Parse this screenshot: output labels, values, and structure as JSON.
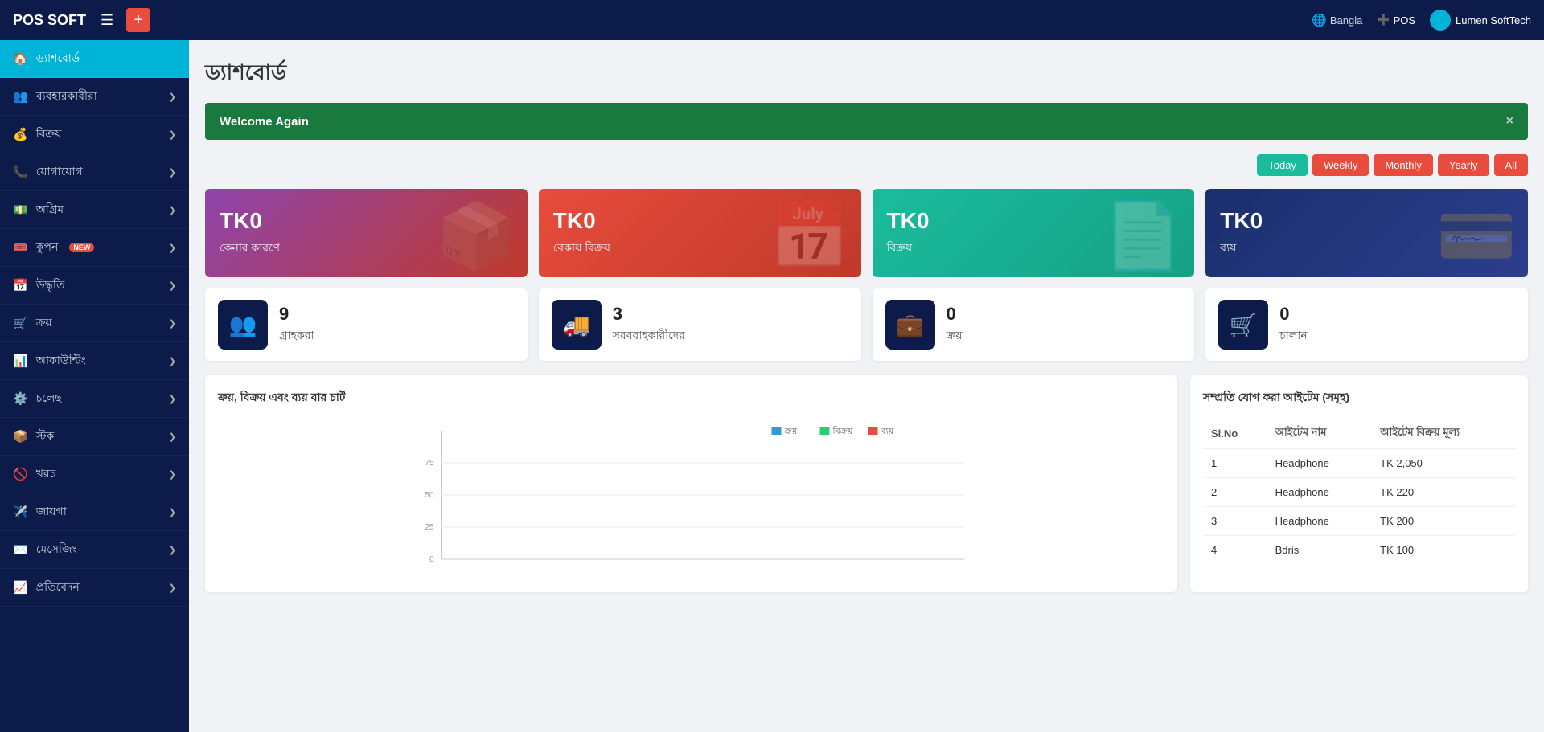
{
  "topbar": {
    "logo": "POS SOFT",
    "hamburger_icon": "☰",
    "plus_label": "+",
    "lang_label": "Bangla",
    "pos_label": "POS",
    "user_label": "Lumen SoftTech",
    "user_avatar": "👤"
  },
  "sidebar": {
    "items": [
      {
        "id": "dashboard",
        "icon": "🏠",
        "label": "ড্যাশবোর্ড",
        "active": true,
        "has_arrow": false,
        "badge": ""
      },
      {
        "id": "users",
        "icon": "👥",
        "label": "ব্যবহারকারীরা",
        "active": false,
        "has_arrow": true,
        "badge": ""
      },
      {
        "id": "sales",
        "icon": "💰",
        "label": "বিক্রয়",
        "active": false,
        "has_arrow": true,
        "badge": ""
      },
      {
        "id": "contact",
        "icon": "📞",
        "label": "যোগাযোগ",
        "active": false,
        "has_arrow": true,
        "badge": ""
      },
      {
        "id": "advance",
        "icon": "💵",
        "label": "অগ্রিম",
        "active": false,
        "has_arrow": true,
        "badge": ""
      },
      {
        "id": "coupon",
        "icon": "🎟️",
        "label": "কুপন",
        "active": false,
        "has_arrow": true,
        "badge": "NEW"
      },
      {
        "id": "motivation",
        "icon": "📅",
        "label": "উদ্ধৃতি",
        "active": false,
        "has_arrow": true,
        "badge": ""
      },
      {
        "id": "purchase",
        "icon": "🛒",
        "label": "ক্রয়",
        "active": false,
        "has_arrow": true,
        "badge": ""
      },
      {
        "id": "accounting",
        "icon": "📊",
        "label": "আকাউন্টিং",
        "active": false,
        "has_arrow": true,
        "badge": ""
      },
      {
        "id": "running",
        "icon": "⚙️",
        "label": "চলেছ",
        "active": false,
        "has_arrow": true,
        "badge": ""
      },
      {
        "id": "stock",
        "icon": "📦",
        "label": "স্টক",
        "active": false,
        "has_arrow": true,
        "badge": ""
      },
      {
        "id": "expense",
        "icon": "🚫",
        "label": "খরচ",
        "active": false,
        "has_arrow": true,
        "badge": ""
      },
      {
        "id": "place",
        "icon": "✈️",
        "label": "জায়গা",
        "active": false,
        "has_arrow": true,
        "badge": ""
      },
      {
        "id": "messaging",
        "icon": "✉️",
        "label": "মেসেজিং",
        "active": false,
        "has_arrow": true,
        "badge": ""
      },
      {
        "id": "report",
        "icon": "📈",
        "label": "প্রতিবেদন",
        "active": false,
        "has_arrow": true,
        "badge": ""
      }
    ]
  },
  "page": {
    "title": "ড্যাশবোর্ড",
    "welcome_text": "Welcome Again",
    "close_btn": "×"
  },
  "filters": {
    "buttons": [
      {
        "id": "today",
        "label": "Today",
        "class": "active-today"
      },
      {
        "id": "weekly",
        "label": "Weekly",
        "class": "weekly"
      },
      {
        "id": "monthly",
        "label": "Monthly",
        "class": "monthly"
      },
      {
        "id": "yearly",
        "label": "Yearly",
        "class": "yearly"
      },
      {
        "id": "all",
        "label": "All",
        "class": "all"
      }
    ]
  },
  "stat_cards": [
    {
      "id": "purchase-due",
      "amount": "TK0",
      "label": "কেনার কারণে",
      "class": "card-purple",
      "icon": "📦"
    },
    {
      "id": "sales-due",
      "amount": "TK0",
      "label": "বেকায় বিক্রয়",
      "class": "card-red",
      "icon": "📅"
    },
    {
      "id": "sales",
      "amount": "TK0",
      "label": "বিক্রয়",
      "class": "card-teal",
      "icon": "📄"
    },
    {
      "id": "expense",
      "amount": "TK0",
      "label": "ব্যয়",
      "class": "card-navy",
      "icon": "💳"
    }
  ],
  "count_cards": [
    {
      "id": "customers",
      "count": "9",
      "label": "গ্রাহকরা",
      "icon": "👥"
    },
    {
      "id": "suppliers",
      "count": "3",
      "label": "সরবরাহকারীদের",
      "icon": "🚚"
    },
    {
      "id": "purchases",
      "count": "0",
      "label": "ক্রয়",
      "icon": "💼"
    },
    {
      "id": "invoices",
      "count": "0",
      "label": "চালান",
      "icon": "🛒"
    }
  ],
  "chart": {
    "title": "ক্রয়, বিক্রয় এবং ব্যয় বার চার্ট"
  },
  "items_panel": {
    "title": "সম্প্রতি যোগ করা আইটেম (সমূহ)",
    "columns": [
      "Sl.No",
      "আইটেম নাম",
      "আইটেম বিক্রয় মূল্য"
    ],
    "rows": [
      {
        "sl": "1",
        "name": "Headphone",
        "price": "TK 2,050"
      },
      {
        "sl": "2",
        "name": "Headphone",
        "price": "TK 220"
      },
      {
        "sl": "3",
        "name": "Headphone",
        "price": "TK 200"
      },
      {
        "sl": "4",
        "name": "Bdris",
        "price": "TK 100"
      }
    ]
  }
}
